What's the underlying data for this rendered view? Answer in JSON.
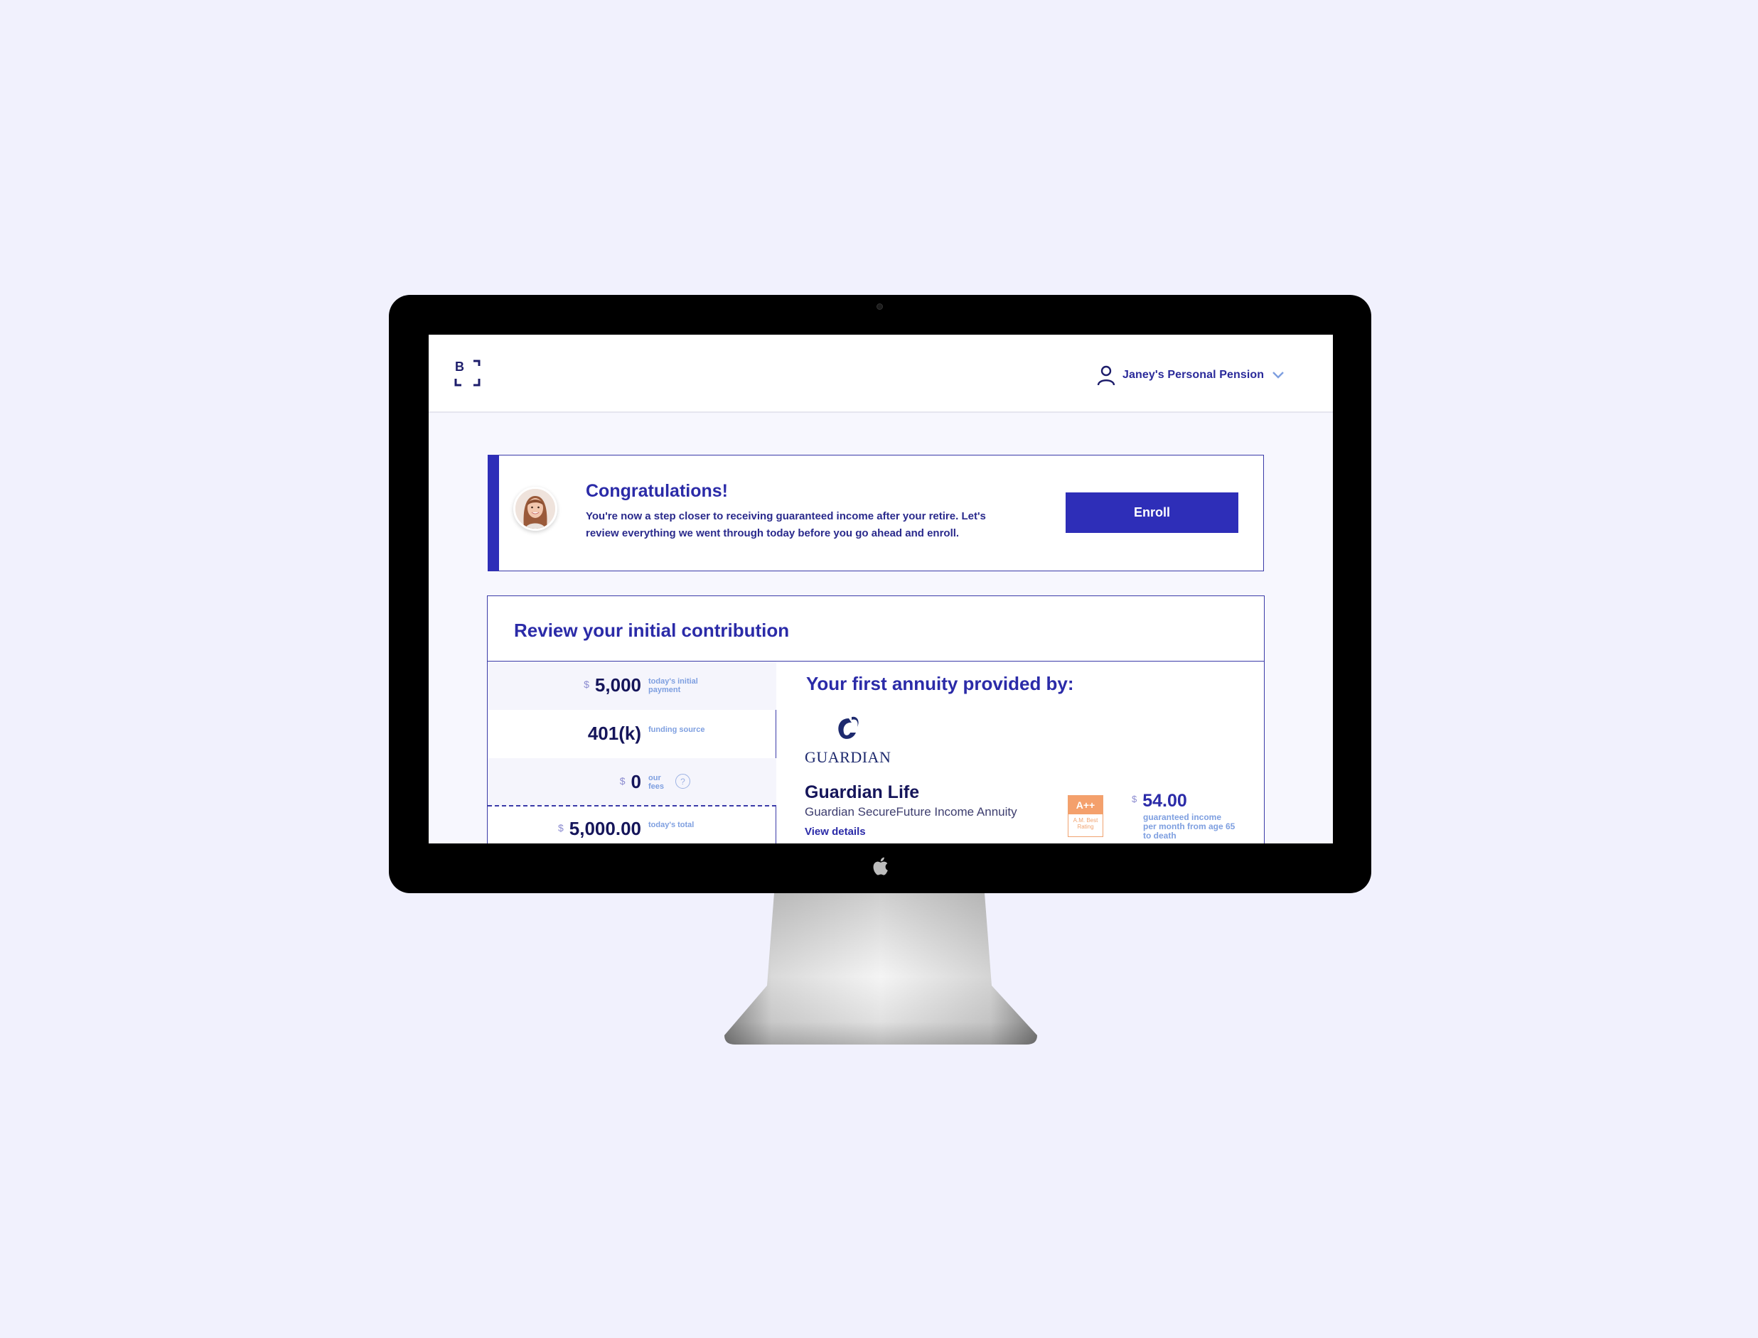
{
  "header": {
    "logo_letter": "B",
    "account_name": "Janey's Personal Pension"
  },
  "banner": {
    "title": "Congratulations!",
    "message": "You're now a step closer to receiving guaranteed income after your retire. Let's review everything we went through today before you go ahead and enroll.",
    "enroll_label": "Enroll"
  },
  "review": {
    "title": "Review your initial contribution",
    "rows": [
      {
        "currency": "$",
        "value": "5,000",
        "label": "today's initial payment"
      },
      {
        "currency": "",
        "value": "401(k)",
        "label": "funding source"
      },
      {
        "currency": "$",
        "value": "0",
        "label": "our fees",
        "help": "?"
      },
      {
        "currency": "$",
        "value": "5,000.00",
        "label": "today's total"
      }
    ]
  },
  "annuity": {
    "title": "Your first annuity provided by:",
    "provider_logo_text": "GUARDIAN",
    "insurer_name": "Guardian Life",
    "product_name": "Guardian SecureFuture Income Annuity",
    "view_details_label": "View details",
    "rating": {
      "grade": "A++",
      "source": "A.M. Best Rating"
    },
    "income": {
      "currency": "$",
      "amount": "54.00",
      "description": "guaranteed income per month from age 65 to death"
    }
  },
  "colors": {
    "brand": "#2e2eb8",
    "page_background": "#f1f1fd",
    "rating": "#f4a06c"
  }
}
